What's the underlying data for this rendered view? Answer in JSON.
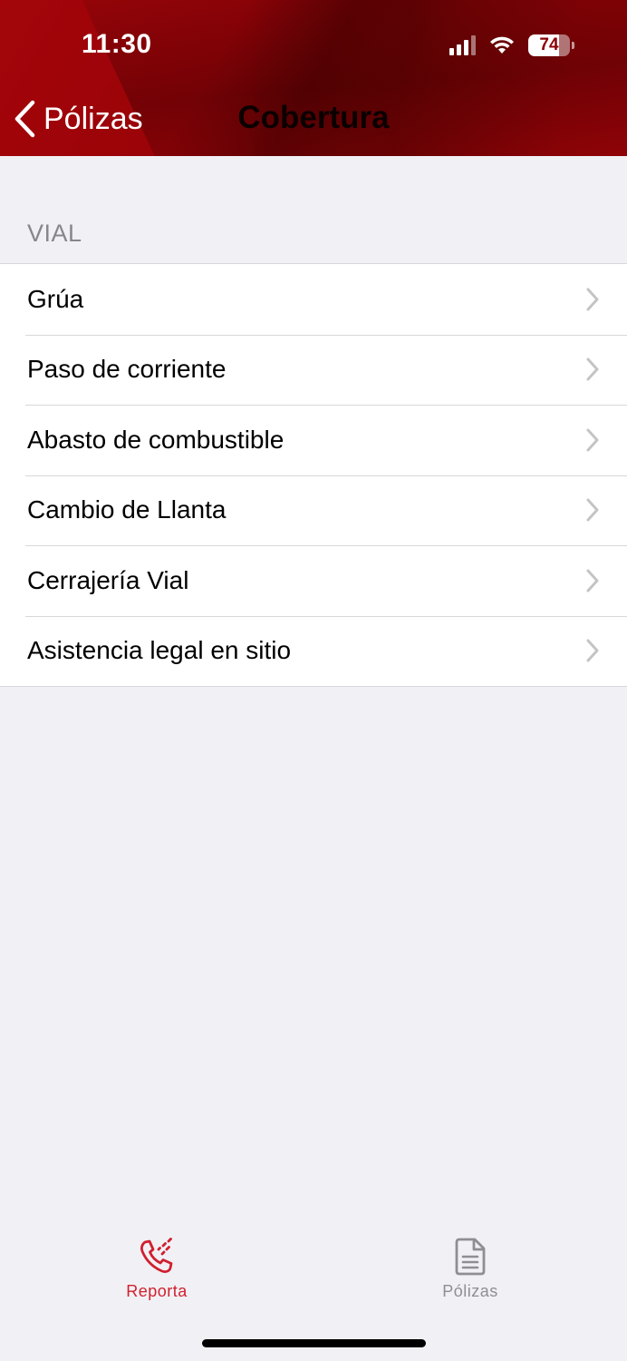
{
  "status_bar": {
    "time": "11:30",
    "battery_percent": "74",
    "battery_level": 0.74
  },
  "nav": {
    "back_label": "Pólizas",
    "title": "Cobertura"
  },
  "section": {
    "header": "VIAL",
    "items": [
      {
        "label": "Grúa"
      },
      {
        "label": "Paso de corriente"
      },
      {
        "label": "Abasto de combustible"
      },
      {
        "label": "Cambio de Llanta"
      },
      {
        "label": "Cerrajería Vial"
      },
      {
        "label": "Asistencia legal en sitio"
      }
    ]
  },
  "tabbar": {
    "tabs": [
      {
        "label": "Reporta",
        "icon": "phone-signal-icon",
        "active": true
      },
      {
        "label": "Pólizas",
        "icon": "document-icon",
        "active": false
      }
    ]
  },
  "colors": {
    "brand": "#9a0308",
    "active_tab": "#d0202e",
    "inactive_tab": "#8e8e93",
    "background": "#f1f1f5"
  }
}
